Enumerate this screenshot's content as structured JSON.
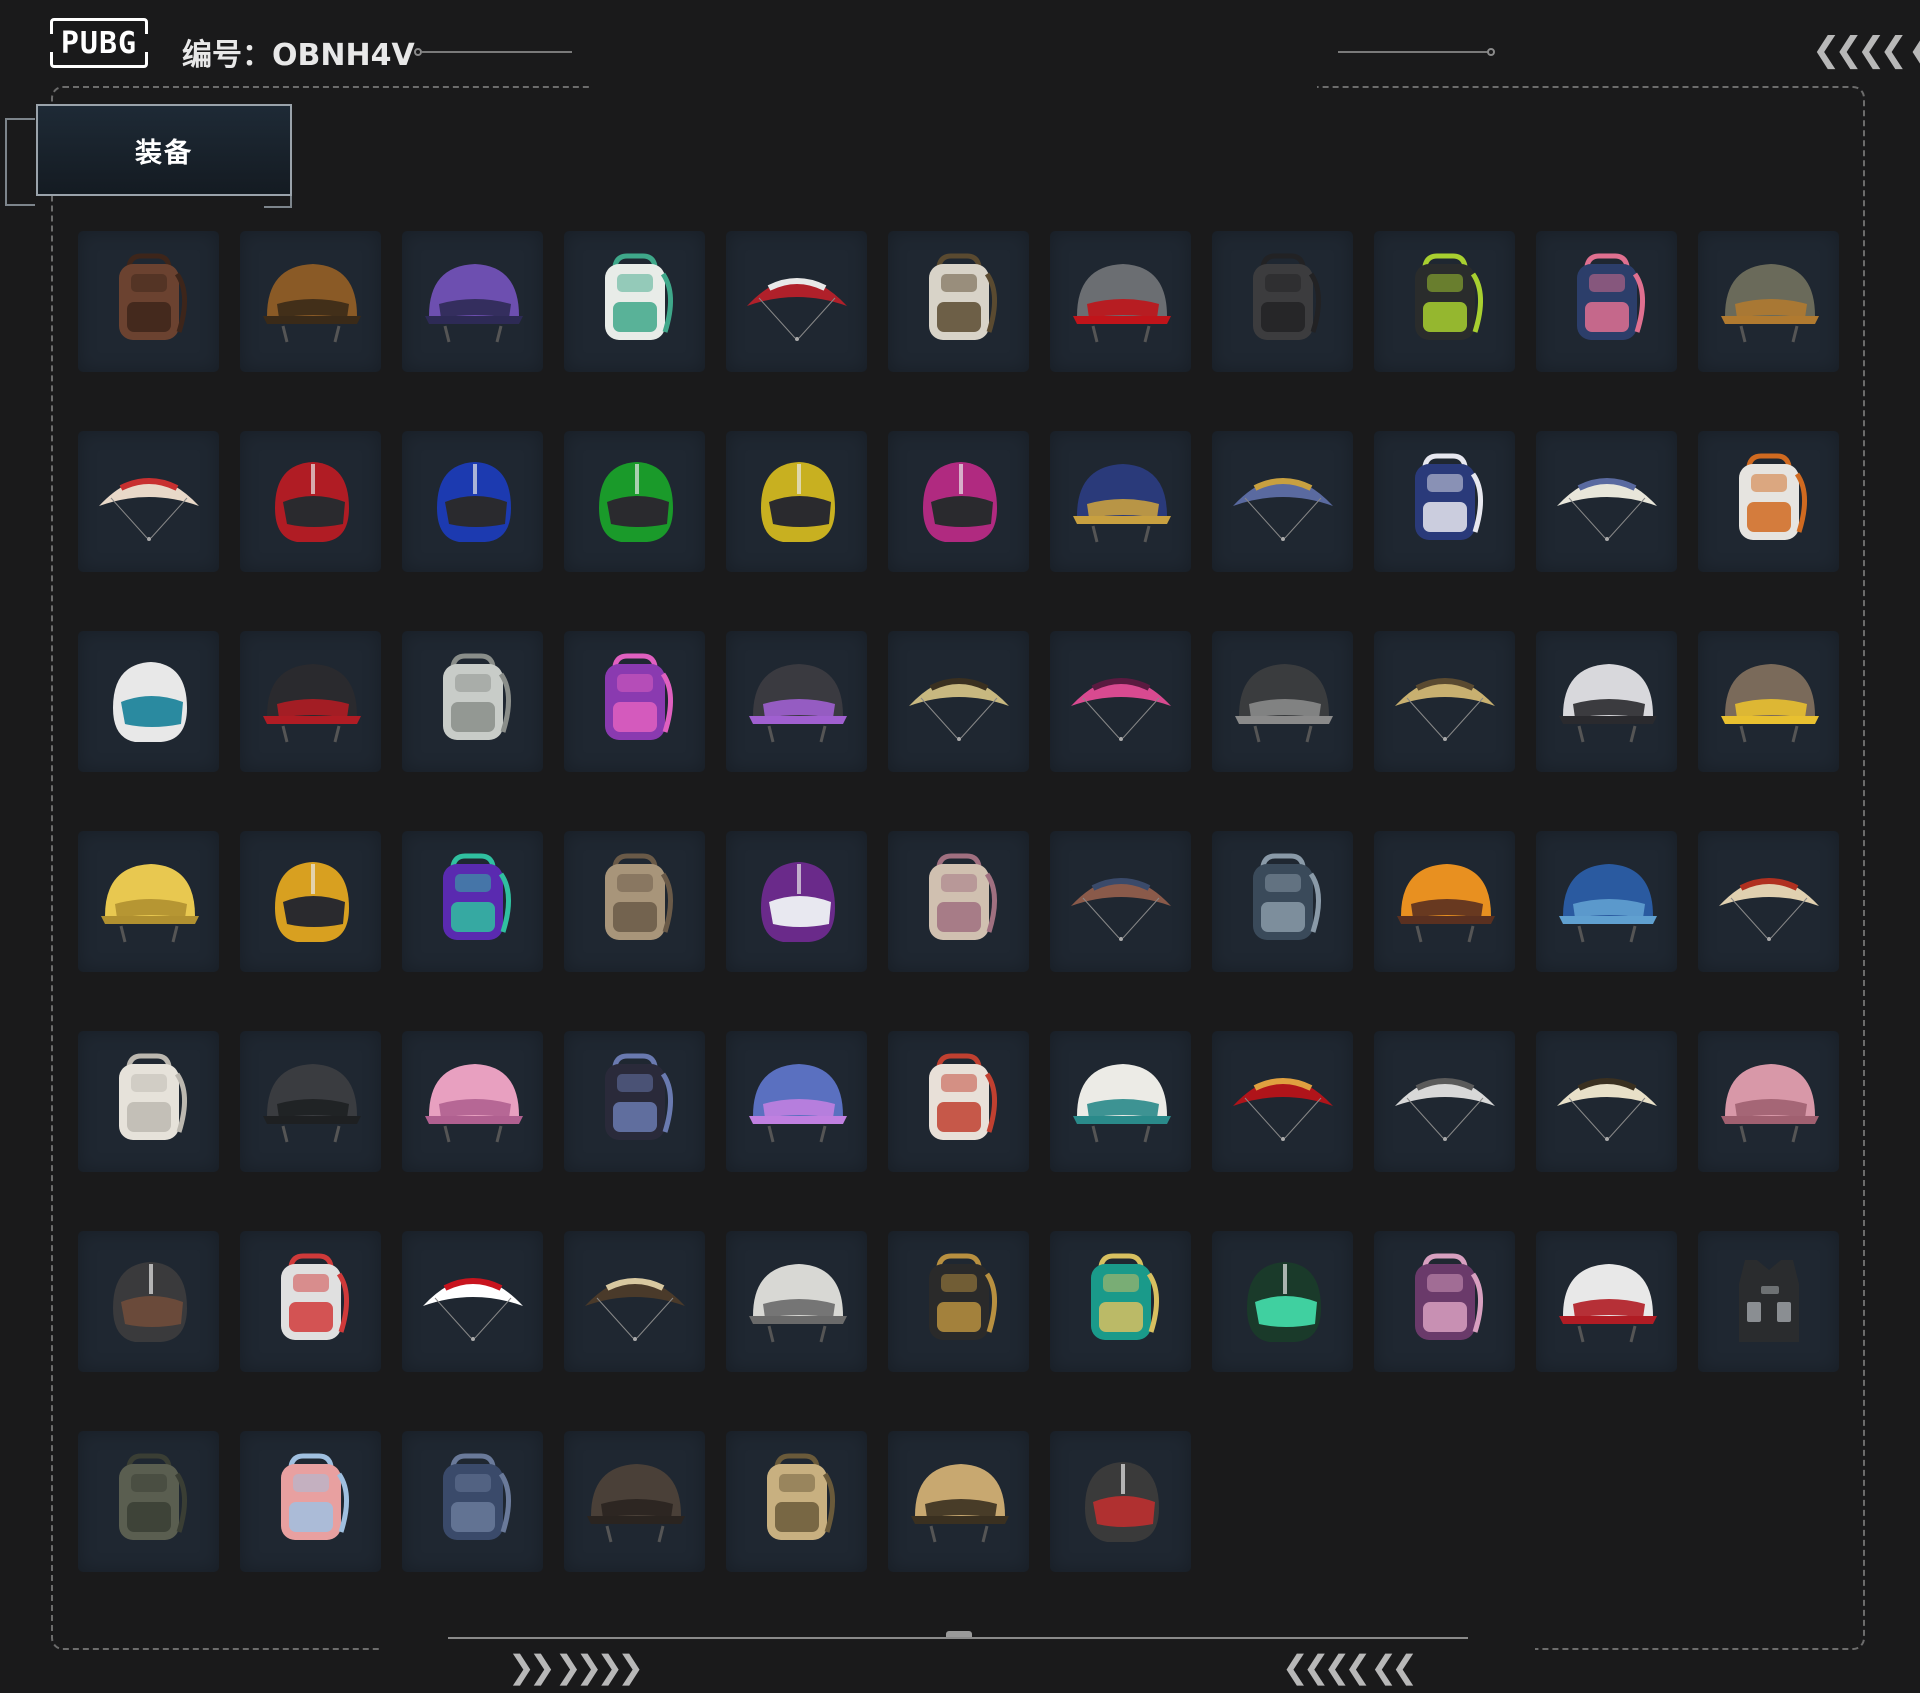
{
  "header": {
    "logo_text": "PUBG",
    "id_label": "编号：OBNH4V",
    "right_chevrons": "❮❮❮❮ ❮"
  },
  "tab": {
    "label": "装备"
  },
  "footer": {
    "left_chevrons": "❯❯ ❯❯❯❯",
    "right_chevrons": "❮❮❮❮ ❮❮"
  },
  "items": [
    {
      "type": "backpack",
      "c1": "#6b4230",
      "c2": "#3d251a"
    },
    {
      "type": "helmet",
      "c1": "#8a5a26",
      "c2": "#3a2a18"
    },
    {
      "type": "helmet",
      "c1": "#6d4fb0",
      "c2": "#2d2a55"
    },
    {
      "type": "backpack",
      "c1": "#e8ece8",
      "c2": "#3fa88a"
    },
    {
      "type": "parachute",
      "c1": "#b0202a",
      "c2": "#e8e8e8"
    },
    {
      "type": "backpack",
      "c1": "#d8d3c8",
      "c2": "#5a4a30"
    },
    {
      "type": "helmet",
      "c1": "#6b6e72",
      "c2": "#c0141a"
    },
    {
      "type": "backpack",
      "c1": "#3c3c3e",
      "c2": "#222224"
    },
    {
      "type": "backpack",
      "c1": "#2a2c2c",
      "c2": "#a8d030"
    },
    {
      "type": "backpack",
      "c1": "#2c3e6a",
      "c2": "#e07090"
    },
    {
      "type": "helmet",
      "c1": "#6a6a5a",
      "c2": "#b07a30"
    },
    {
      "type": "parachute",
      "c1": "#e8d8c8",
      "c2": "#c83030"
    },
    {
      "type": "moto",
      "c1": "#b01c24",
      "c2": "#2a2a2e"
    },
    {
      "type": "moto",
      "c1": "#1c3ab0",
      "c2": "#2a2a2e"
    },
    {
      "type": "moto",
      "c1": "#1a9a2a",
      "c2": "#2a2a2e"
    },
    {
      "type": "moto",
      "c1": "#c8b020",
      "c2": "#2a2a2e"
    },
    {
      "type": "moto",
      "c1": "#b02a80",
      "c2": "#2a2a2e"
    },
    {
      "type": "helmet",
      "c1": "#2a3a7a",
      "c2": "#c8a040"
    },
    {
      "type": "parachute",
      "c1": "#5a6aa0",
      "c2": "#c8a040"
    },
    {
      "type": "backpack",
      "c1": "#2a3a7a",
      "c2": "#e8e8f0"
    },
    {
      "type": "parachute",
      "c1": "#e8e6da",
      "c2": "#5a6aa0"
    },
    {
      "type": "backpack",
      "c1": "#e6e4e0",
      "c2": "#d06a20"
    },
    {
      "type": "moto",
      "c1": "#e8e8e8",
      "c2": "#2a8aa0"
    },
    {
      "type": "helmet",
      "c1": "#2a2a2e",
      "c2": "#b01c24"
    },
    {
      "type": "backpack",
      "c1": "#c8ccc8",
      "c2": "#8a8e8a"
    },
    {
      "type": "backpack",
      "c1": "#8a3ab0",
      "c2": "#e060c0"
    },
    {
      "type": "helmet",
      "c1": "#3a3a40",
      "c2": "#a060d0"
    },
    {
      "type": "parachute",
      "c1": "#c8b880",
      "c2": "#3a3020"
    },
    {
      "type": "parachute",
      "c1": "#d84a90",
      "c2": "#5a1a40"
    },
    {
      "type": "helmet",
      "c1": "#3a3c3e",
      "c2": "#8a8a8a"
    },
    {
      "type": "parachute",
      "c1": "#c8b070",
      "c2": "#5a4a30"
    },
    {
      "type": "helmet",
      "c1": "#d8d8dc",
      "c2": "#2a2a2e"
    },
    {
      "type": "helmet",
      "c1": "#7a6a5a",
      "c2": "#e8c030"
    },
    {
      "type": "helmet",
      "c1": "#e8c850",
      "c2": "#b09030"
    },
    {
      "type": "moto",
      "c1": "#d8a020",
      "c2": "#2a2a2e"
    },
    {
      "type": "backpack",
      "c1": "#5a2ab0",
      "c2": "#30c0a0"
    },
    {
      "type": "backpack",
      "c1": "#a8957a",
      "c2": "#6a5a48"
    },
    {
      "type": "moto",
      "c1": "#6a2a8a",
      "c2": "#e8e8f0"
    },
    {
      "type": "backpack",
      "c1": "#d0c0b0",
      "c2": "#a07080"
    },
    {
      "type": "parachute",
      "c1": "#8a5a4a",
      "c2": "#3a4a6a"
    },
    {
      "type": "backpack",
      "c1": "#3a4a5a",
      "c2": "#8a9aa8"
    },
    {
      "type": "helmet",
      "c1": "#e89020",
      "c2": "#5a3020"
    },
    {
      "type": "helmet",
      "c1": "#2a5aa0",
      "c2": "#60a0d0"
    },
    {
      "type": "parachute",
      "c1": "#e0d0b0",
      "c2": "#b03020"
    },
    {
      "type": "backpack",
      "c1": "#e6e2da",
      "c2": "#bcb8b0"
    },
    {
      "type": "helmet",
      "c1": "#3a3c40",
      "c2": "#1e2022"
    },
    {
      "type": "helmet",
      "c1": "#e8a0c0",
      "c2": "#b06090"
    },
    {
      "type": "backpack",
      "c1": "#2a2a3a",
      "c2": "#6a7ab0"
    },
    {
      "type": "helmet",
      "c1": "#5a70c0",
      "c2": "#c080e0"
    },
    {
      "type": "backpack",
      "c1": "#e8e0d8",
      "c2": "#c04030"
    },
    {
      "type": "helmet",
      "c1": "#ecebe6",
      "c2": "#2a8a8a"
    },
    {
      "type": "parachute",
      "c1": "#b0141a",
      "c2": "#e0a040"
    },
    {
      "type": "parachute",
      "c1": "#d8d8d8",
      "c2": "#5a5a5a"
    },
    {
      "type": "parachute",
      "c1": "#e8e0c8",
      "c2": "#3a3020"
    },
    {
      "type": "helmet",
      "c1": "#d898a8",
      "c2": "#a06070"
    },
    {
      "type": "moto",
      "c1": "#3a3a3c",
      "c2": "#6a4a3a"
    },
    {
      "type": "backpack",
      "c1": "#e0e0e0",
      "c2": "#d03a3a"
    },
    {
      "type": "parachute",
      "c1": "#ffffff",
      "c2": "#c8141e"
    },
    {
      "type": "parachute",
      "c1": "#4a3a2a",
      "c2": "#d8c8a0"
    },
    {
      "type": "helmet",
      "c1": "#d8d8d4",
      "c2": "#6a6a6a"
    },
    {
      "type": "backpack",
      "c1": "#2a2a2a",
      "c2": "#b89040"
    },
    {
      "type": "backpack",
      "c1": "#1a9a8a",
      "c2": "#d8c060"
    },
    {
      "type": "moto",
      "c1": "#1a3a2a",
      "c2": "#40d0a0"
    },
    {
      "type": "backpack",
      "c1": "#6a3a6a",
      "c2": "#d8a0c0"
    },
    {
      "type": "helmet",
      "c1": "#e8e8e8",
      "c2": "#b01c24"
    },
    {
      "type": "vest",
      "c1": "#2a2c2e",
      "c2": "#8a8e92"
    },
    {
      "type": "backpack",
      "c1": "#5a5e50",
      "c2": "#3a3e34"
    },
    {
      "type": "backpack",
      "c1": "#e8a0a0",
      "c2": "#a0c0e0"
    },
    {
      "type": "backpack",
      "c1": "#3a4a6a",
      "c2": "#6a7a9a"
    },
    {
      "type": "helmet",
      "c1": "#4a4038",
      "c2": "#2a2420"
    },
    {
      "type": "backpack",
      "c1": "#c8b080",
      "c2": "#6a5a3a"
    },
    {
      "type": "helmet",
      "c1": "#c8a870",
      "c2": "#3a3020"
    },
    {
      "type": "moto",
      "c1": "#3a3a3a",
      "c2": "#b03030"
    }
  ]
}
